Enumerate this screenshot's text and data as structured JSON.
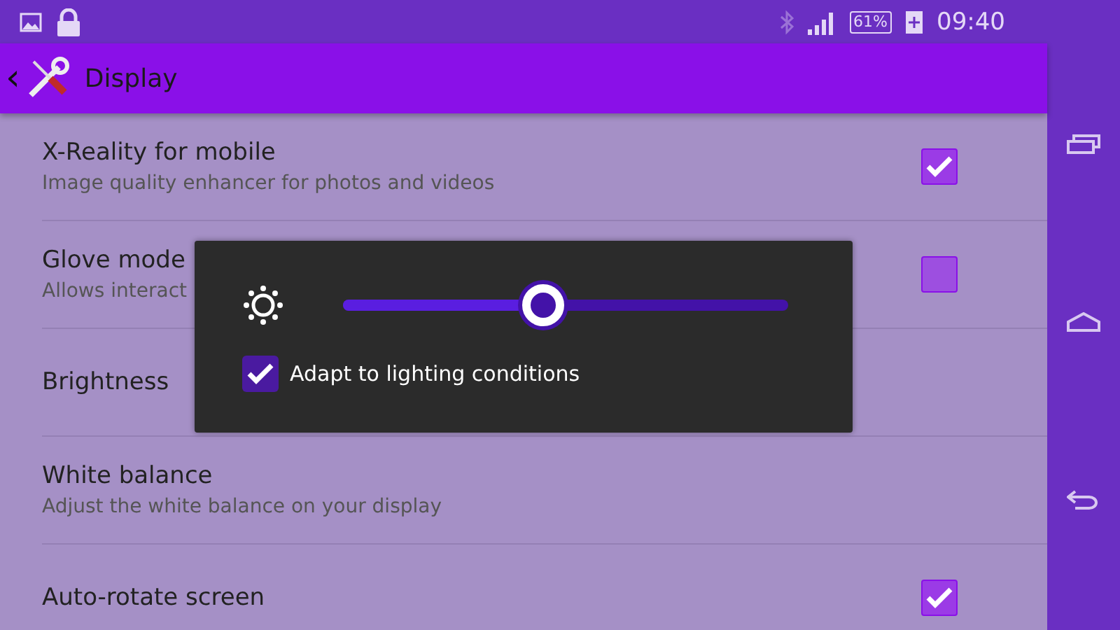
{
  "status_bar": {
    "battery": "61%",
    "time": "09:40"
  },
  "action_bar": {
    "back": "‹",
    "title": "Display"
  },
  "settings": [
    {
      "kind": "checkbox",
      "title": "X-Reality for mobile",
      "subtitle": "Image quality enhancer for photos and videos",
      "checked": true
    },
    {
      "kind": "checkbox",
      "title": "Glove mode",
      "subtitle": "Allows interact",
      "checked": false
    },
    {
      "kind": "plain",
      "title": "Brightness"
    },
    {
      "kind": "plain",
      "title": "White balance",
      "subtitle": "Adjust the white balance on your display"
    },
    {
      "kind": "checkbox",
      "title": "Auto-rotate screen",
      "checked": true
    }
  ],
  "brightness_dialog": {
    "level": 0.45,
    "adapt": {
      "label": "Adapt to lighting conditions",
      "checked": true
    }
  }
}
